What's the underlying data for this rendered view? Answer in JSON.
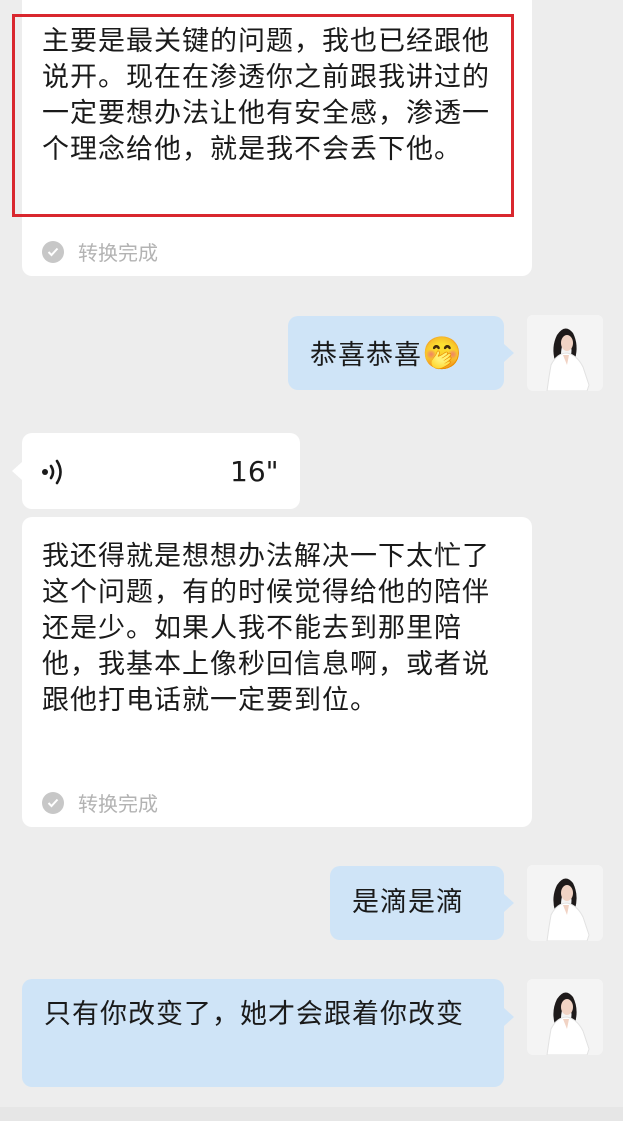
{
  "messages": [
    {
      "text": "主要是最关键的问题，我也已经跟他说开。现在在渗透你之前跟我讲过的一定要想办法让他有安全感，渗透一个理念给他，就是我不会丢下他。",
      "status": "转换完成"
    },
    {
      "text": "恭喜恭喜",
      "emoji": "🤭"
    },
    {
      "voice_duration": "16\""
    },
    {
      "text": "我还得就是想想办法解决一下太忙了这个问题，有的时候觉得给他的陪伴还是少。如果人我不能去到那里陪他，我基本上像秒回信息啊，或者说跟他打电话就一定要到位。",
      "status": "转换完成"
    },
    {
      "text": "是滴是滴"
    },
    {
      "text": "只有你改变了，她才会跟着你改变"
    }
  ],
  "colors": {
    "background": "#ededed",
    "bubble_incoming": "#ffffff",
    "bubble_outgoing": "#cfe4f7",
    "highlight_border": "#d9272e"
  },
  "icons": {
    "status": "check-circle-icon",
    "voice": "voice-wave-icon",
    "avatar": "profile-photo"
  }
}
